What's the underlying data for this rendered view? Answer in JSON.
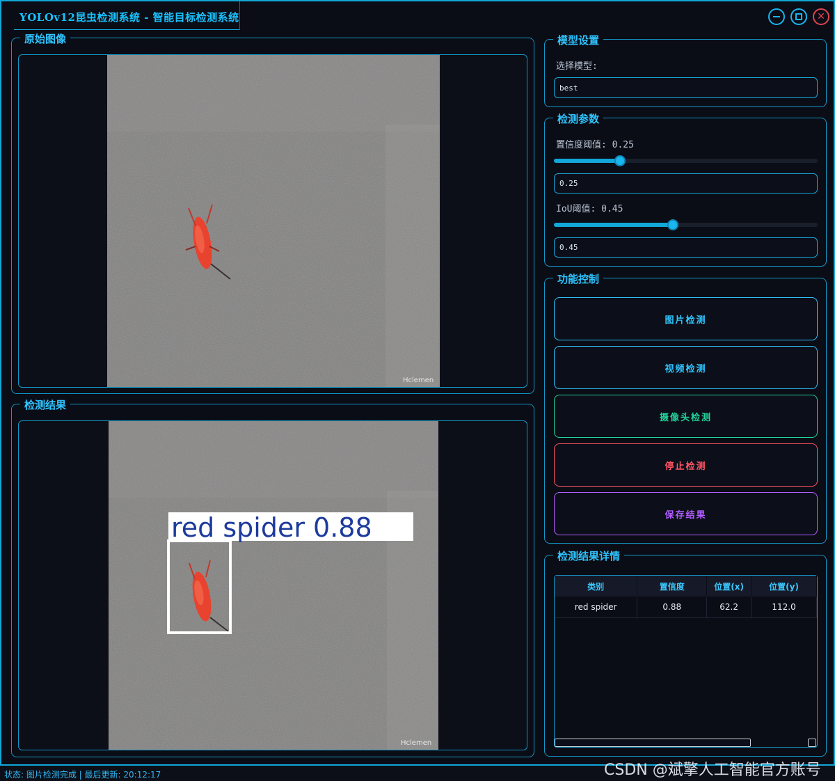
{
  "window": {
    "title": "YOLOv12昆虫检测系统 - 智能目标检测系统",
    "close_glyph": "✕"
  },
  "original_panel": {
    "title": "原始图像",
    "watermark_text": "Hclemen"
  },
  "result_panel": {
    "title": "检测结果",
    "detection_label": "red spider 0.88",
    "watermark_text": "Hclemen"
  },
  "model_settings": {
    "title": "模型设置",
    "select_label": "选择模型:",
    "selected_model": "best"
  },
  "detection_params": {
    "title": "检测参数",
    "confidence_label": "置信度阈值: 0.25",
    "confidence_value": "0.25",
    "confidence_fraction": 0.25,
    "iou_label": "IoU阈值: 0.45",
    "iou_value": "0.45",
    "iou_fraction": 0.45
  },
  "function_control": {
    "title": "功能控制",
    "buttons": [
      {
        "label": "图片检测",
        "color": "#2fc4ff"
      },
      {
        "label": "视频检测",
        "color": "#2fc4ff"
      },
      {
        "label": "摄像头检测",
        "color": "#22d39a"
      },
      {
        "label": "停止检测",
        "color": "#ff5464"
      },
      {
        "label": "保存结果",
        "color": "#b25cff"
      }
    ]
  },
  "result_details": {
    "title": "检测结果详情",
    "columns": [
      "类别",
      "置信度",
      "位置(x)",
      "位置(y)"
    ],
    "rows": [
      [
        "red spider",
        "0.88",
        "62.2",
        "112.0"
      ]
    ]
  },
  "status_bar": {
    "text": "状态: 图片检测完成 | 最后更新: 20:12:17"
  },
  "watermark": "CSDN @斌擎人工智能官方账号",
  "colors": {
    "accent": "#12a7d8",
    "background": "#0b0d16",
    "detection_box": "#ffffff",
    "label_text": "#1d3b9c"
  }
}
